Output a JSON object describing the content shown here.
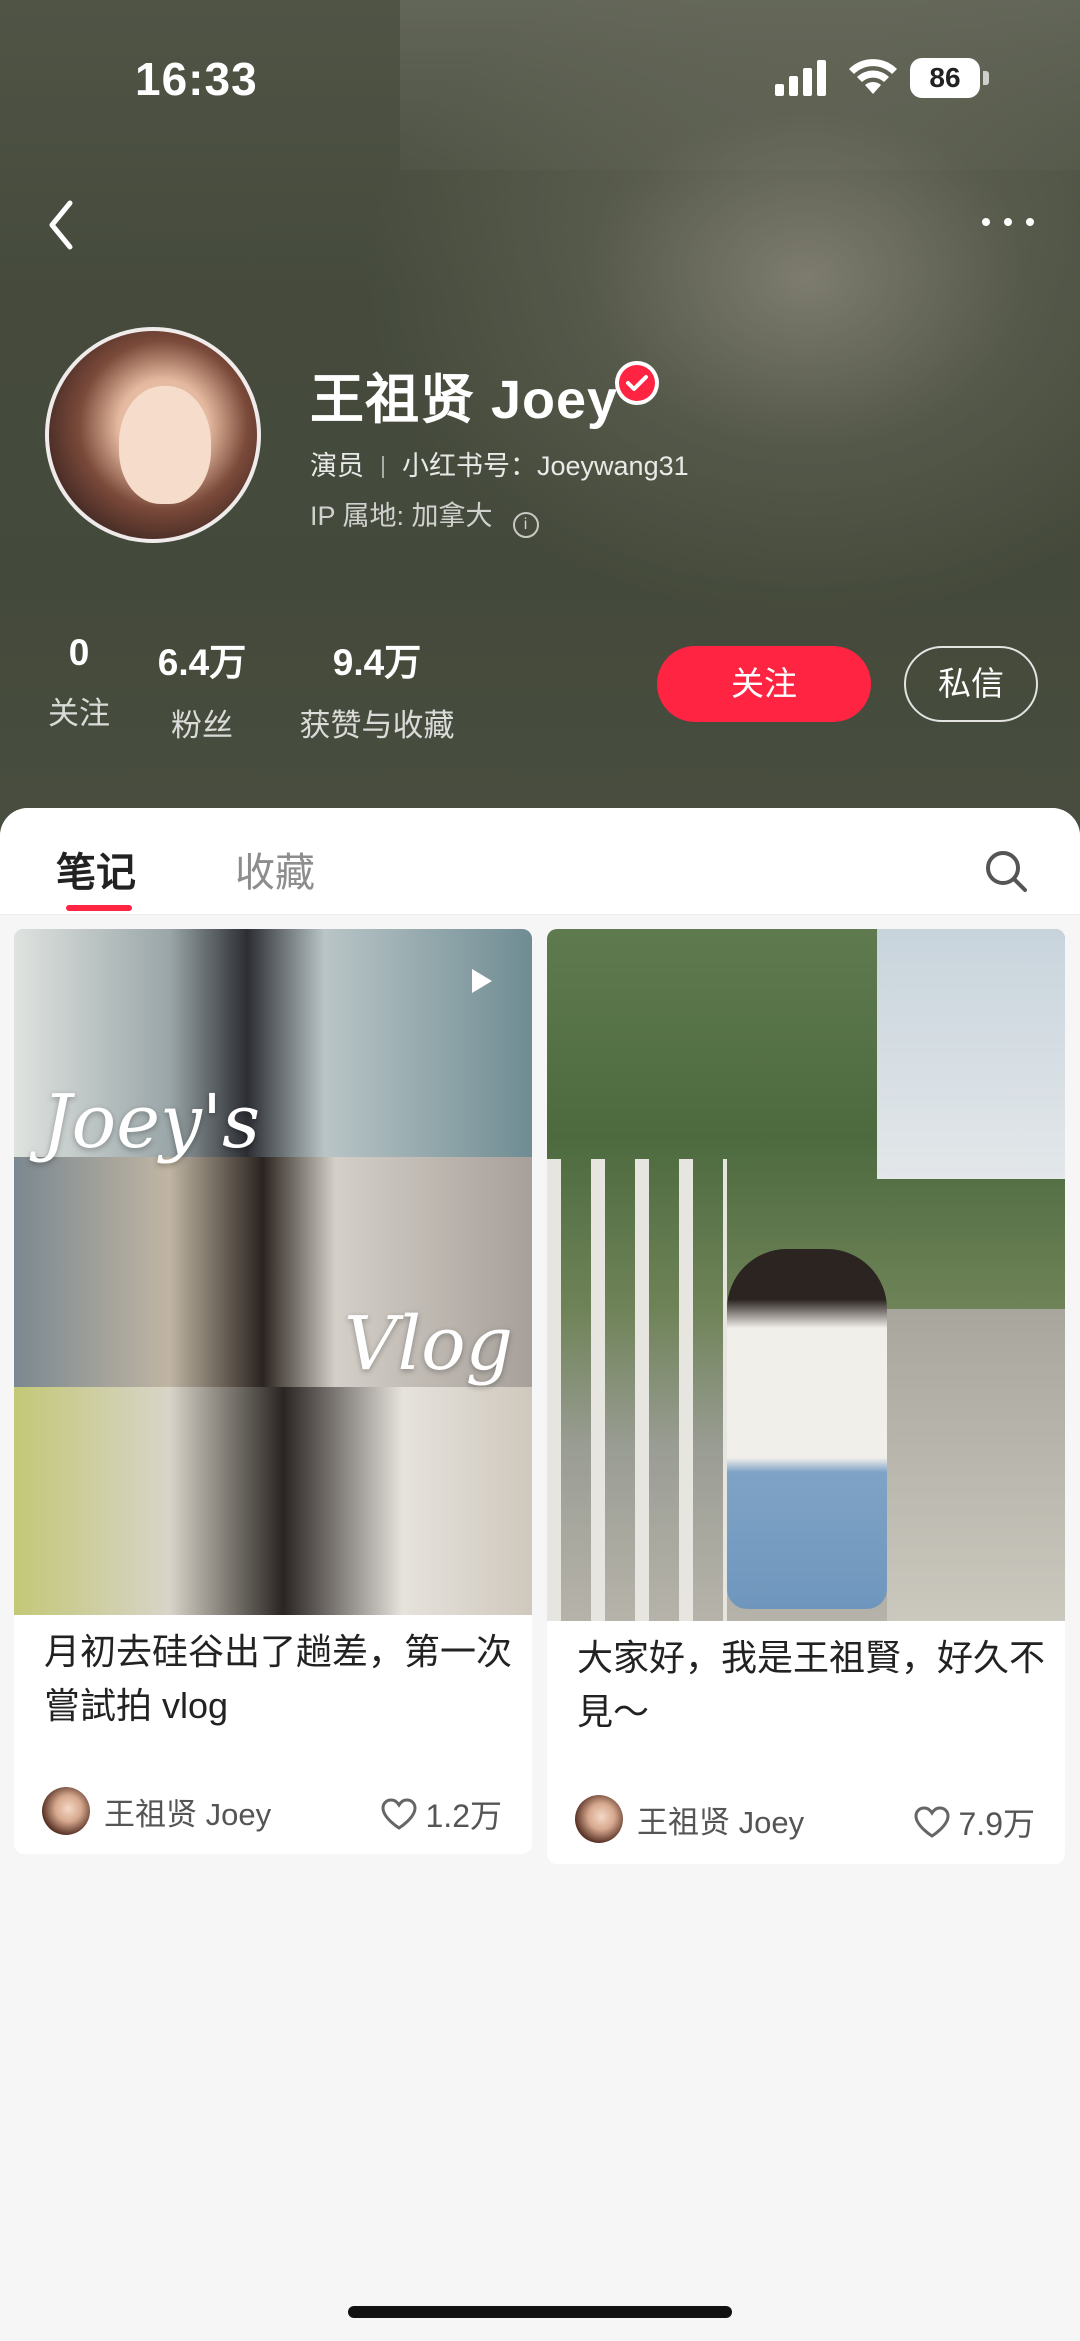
{
  "status_bar": {
    "time": "16:33",
    "battery": "86"
  },
  "profile": {
    "name": "王祖贤 Joey",
    "occupation": "演员",
    "xhs_id": "小红书号：Joeywang31",
    "ip": "IP 属地: 加拿大",
    "verified_icon": "verified-check-icon"
  },
  "stats": [
    {
      "value": "0",
      "label": "关注"
    },
    {
      "value": "6.4万",
      "label": "粉丝"
    },
    {
      "value": "9.4万",
      "label": "获赞与收藏"
    }
  ],
  "actions": {
    "follow": "关注",
    "message": "私信"
  },
  "tabs": [
    {
      "label": "笔记"
    },
    {
      "label": "收藏"
    }
  ],
  "notes": [
    {
      "title": "月初去硅谷出了趟差，第一次嘗試拍 vlog",
      "author": "王祖贤 Joey",
      "likes": "1.2万",
      "overlay_top": "Joey's",
      "overlay_bottom": "Vlog"
    },
    {
      "title": "大家好，我是王祖賢，好久不見～",
      "author": "王祖贤 Joey",
      "likes": "7.9万"
    }
  ],
  "colors": {
    "accent": "#ff2442",
    "header_bg": "#4f5545",
    "content_bg": "#f6f6f7"
  }
}
